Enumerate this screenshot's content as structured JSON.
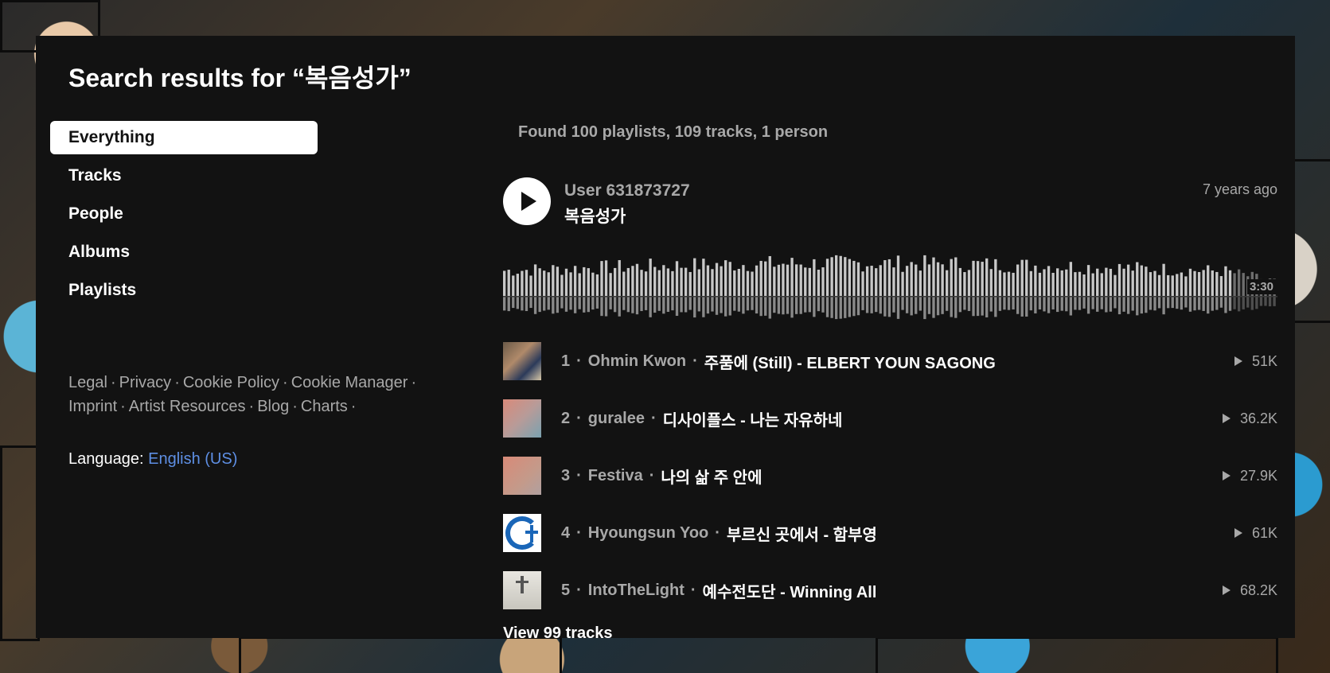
{
  "page": {
    "title_prefix": "Search results for “",
    "query": "복음성가",
    "title_suffix": "”"
  },
  "colors": {
    "panel_bg": "#121212",
    "accent_link": "#5e8fe4",
    "muted_text": "#a8a8a8"
  },
  "sidebar": {
    "items": [
      {
        "label": "Everything",
        "active": true
      },
      {
        "label": "Tracks",
        "active": false
      },
      {
        "label": "People",
        "active": false
      },
      {
        "label": "Albums",
        "active": false
      },
      {
        "label": "Playlists",
        "active": false
      }
    ],
    "footer_links": [
      "Legal",
      "Privacy",
      "Cookie Policy",
      "Cookie Manager",
      "Imprint",
      "Artist Resources",
      "Blog",
      "Charts"
    ],
    "language_label": "Language:",
    "language_value": "English (US)"
  },
  "results": {
    "summary": "Found 100 playlists, 109 tracks, 1 person",
    "featured": {
      "artist": "User 631873727",
      "title": "복음성가",
      "posted": "7 years ago",
      "duration": "3:30",
      "icon": "play-icon"
    },
    "tracks": [
      {
        "num": "1",
        "artist": "Ohmin Kwon",
        "title": "주품에 (Still) - ELBERT YOUN SAGONG",
        "plays": "51K"
      },
      {
        "num": "2",
        "artist": "guralee",
        "title": "디사이플스 - 나는 자유하네",
        "plays": "36.2K"
      },
      {
        "num": "3",
        "artist": "Festiva",
        "title": "나의 삶 주 안에",
        "plays": "27.9K"
      },
      {
        "num": "4",
        "artist": "Hyoungsun Yoo",
        "title": "부르신 곳에서 - 함부영",
        "plays": "61K"
      },
      {
        "num": "5",
        "artist": "IntoTheLight",
        "title": "예수전도단 - Winning All",
        "plays": "68.2K"
      }
    ],
    "view_all": "View 99 tracks"
  }
}
